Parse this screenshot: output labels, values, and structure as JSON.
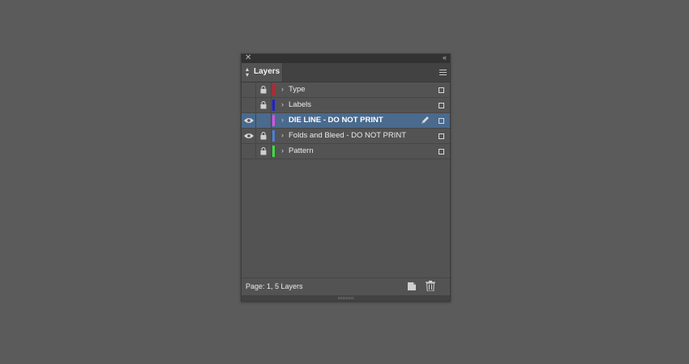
{
  "panel": {
    "title_icons": {
      "close": "close-icon",
      "collapse": "collapse-icon"
    },
    "tab": {
      "label": "Layers",
      "arrows": "⌃⌄"
    },
    "menu_icon": "panel-menu-icon"
  },
  "layers": [
    {
      "name": "Type",
      "visible": false,
      "locked": true,
      "color": "#c8202a",
      "selected": false
    },
    {
      "name": "Labels",
      "visible": false,
      "locked": true,
      "color": "#1f1fd6",
      "selected": false
    },
    {
      "name": "DIE LINE - DO NOT PRINT",
      "visible": true,
      "locked": false,
      "color": "#e24bde",
      "selected": true
    },
    {
      "name": "Folds and Bleed - DO NOT PRINT",
      "visible": true,
      "locked": true,
      "color": "#4a7fd9",
      "selected": false
    },
    {
      "name": "Pattern",
      "visible": false,
      "locked": true,
      "color": "#3fdc3f",
      "selected": false
    }
  ],
  "footer": {
    "label": "Page: 1, 5 Layers"
  }
}
